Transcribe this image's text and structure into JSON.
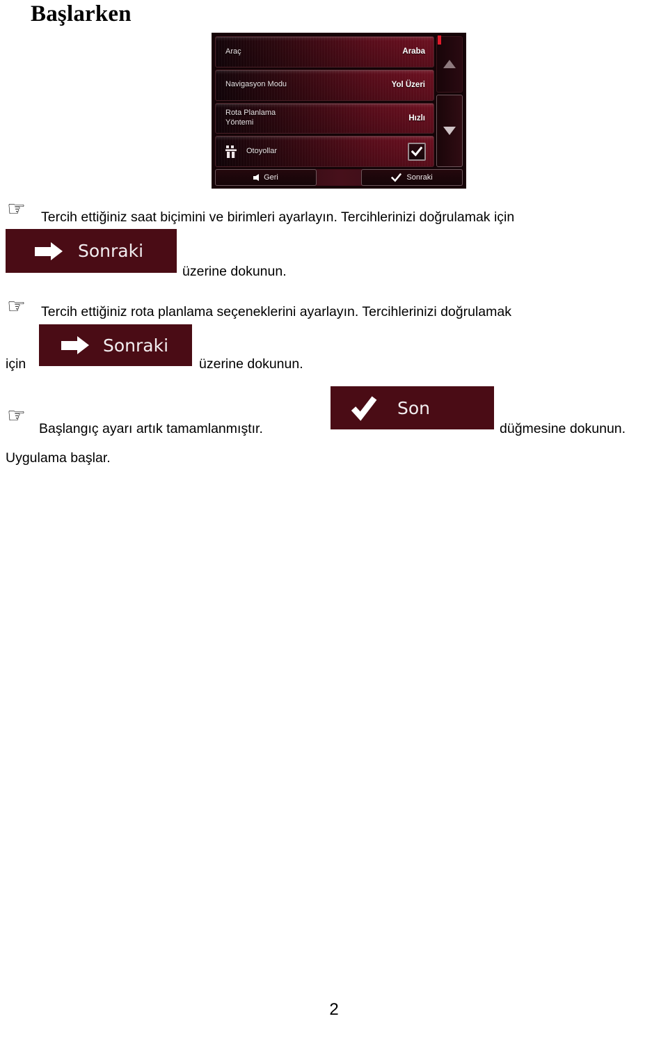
{
  "document": {
    "title": "Başlarken",
    "page_number": "2"
  },
  "device_screen": {
    "rows": [
      {
        "label": "Araç",
        "value": "Araba",
        "icon": null,
        "control": "value"
      },
      {
        "label": "Navigasyon Modu",
        "value": "Yol Üzeri",
        "icon": null,
        "control": "value"
      },
      {
        "label": "Rota Planlama\nYöntemi",
        "label_line1": "Rota Planlama",
        "label_line2": "Yöntemi",
        "value": "Hızlı",
        "icon": null,
        "control": "value"
      },
      {
        "label": "Otoyollar",
        "value": "",
        "icon": "motorway-icon",
        "control": "checkbox",
        "checked": true
      }
    ],
    "scrollbar": {
      "up_icon": "triangle-up-icon",
      "down_icon": "triangle-down-icon",
      "position_marker_color": "#e01b2b"
    },
    "footer": {
      "back_label": "Geri",
      "back_icon": "arrow-left-icon",
      "next_label": "Sonraki",
      "next_icon": "check-icon"
    },
    "colors": {
      "row_gradient_start": "#14050a",
      "row_gradient_end": "#6b1020",
      "screen_background": "#140407"
    }
  },
  "instructions": [
    {
      "hand_icon": "pointing-hand-icon",
      "text_before": "Tercih ettiğiniz saat biçimini ve birimleri ayarlayın. Tercihlerinizi doğrulamak için",
      "button": {
        "label": "Sonraki",
        "icon": "arrow-right-icon",
        "color": "#4a0c15"
      },
      "text_after": "üzerine dokunun."
    },
    {
      "hand_icon": "pointing-hand-icon",
      "text_before": "Tercih ettiğiniz rota planlama seçeneklerini ayarlayın. Tercihlerinizi doğrulamak",
      "text_lead": "için",
      "button": {
        "label": "Sonraki",
        "icon": "arrow-right-icon",
        "color": "#4a0c15"
      },
      "text_after": "üzerine dokunun."
    },
    {
      "hand_icon": "pointing-hand-icon",
      "text_before": "Başlangıç ayarı artık tamamlanmıştır.",
      "button": {
        "label": "Son",
        "icon": "check-icon",
        "color": "#4a0c15"
      },
      "text_after": "düğmesine dokunun.",
      "text_tail": "Uygulama başlar."
    }
  ]
}
